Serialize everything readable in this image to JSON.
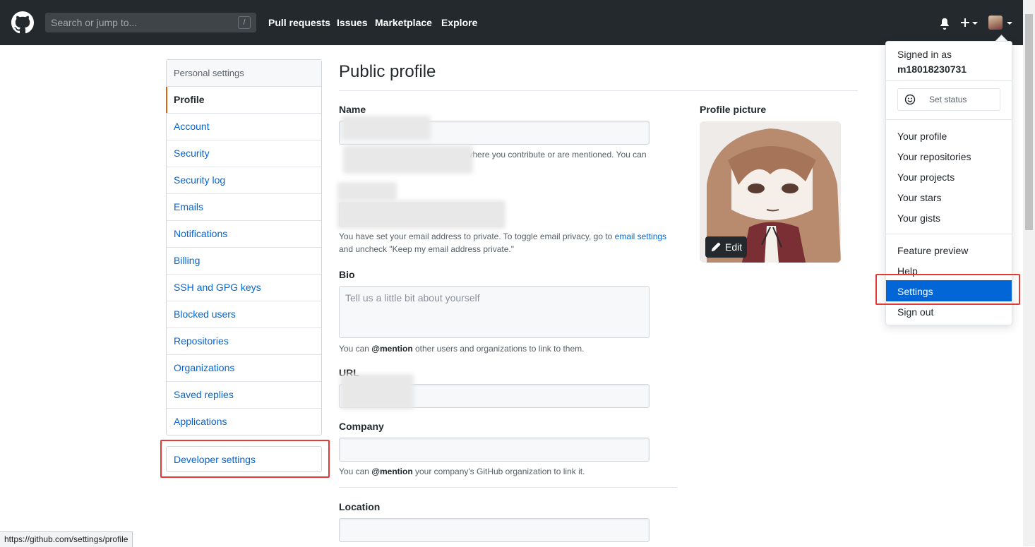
{
  "header": {
    "search_placeholder": "Search or jump to...",
    "search_shortcut": "/",
    "nav": [
      "Pull requests",
      "Issues",
      "Marketplace",
      "Explore"
    ]
  },
  "sidebar": {
    "heading": "Personal settings",
    "items": [
      {
        "label": "Profile",
        "selected": true
      },
      {
        "label": "Account"
      },
      {
        "label": "Security"
      },
      {
        "label": "Security log"
      },
      {
        "label": "Emails"
      },
      {
        "label": "Notifications"
      },
      {
        "label": "Billing"
      },
      {
        "label": "SSH and GPG keys"
      },
      {
        "label": "Blocked users"
      },
      {
        "label": "Repositories"
      },
      {
        "label": "Organizations"
      },
      {
        "label": "Saved replies"
      },
      {
        "label": "Applications"
      }
    ],
    "developer_settings": "Developer settings"
  },
  "main": {
    "title": "Public profile",
    "name_label": "Name",
    "name_note": "d GitHub where you contribute or are mentioned. You can",
    "email_note_1": "You have set your email address to private. To toggle email privacy, go to",
    "email_settings_link": "email settings",
    "email_note_2": "and uncheck \"Keep my email address private.\"",
    "bio_label": "Bio",
    "bio_placeholder": "Tell us a little bit about yourself",
    "bio_note_pre": "You can",
    "bio_note_mention": "@mention",
    "bio_note_post": "other users and organizations to link to them.",
    "url_label": "URL",
    "company_label": "Company",
    "company_note_pre": "You can",
    "company_note_mention": "@mention",
    "company_note_post": "your company's GitHub organization to link it.",
    "location_label": "Location"
  },
  "profile_picture": {
    "label": "Profile picture",
    "edit_button": "Edit"
  },
  "dropdown": {
    "signed_in_as": "Signed in as",
    "username": "m18018230731",
    "set_status": "Set status",
    "items_1": [
      "Your profile",
      "Your repositories",
      "Your projects",
      "Your stars",
      "Your gists"
    ],
    "items_2": [
      "Feature preview",
      "Help",
      "Settings",
      "Sign out"
    ]
  },
  "statusbar_url": "https://github.com/settings/profile",
  "colors": {
    "header_bg": "#24292e",
    "link": "#0366d6",
    "selected_accent": "#e36209",
    "highlight_box": "#e53935",
    "menu_active": "#0366d6"
  }
}
